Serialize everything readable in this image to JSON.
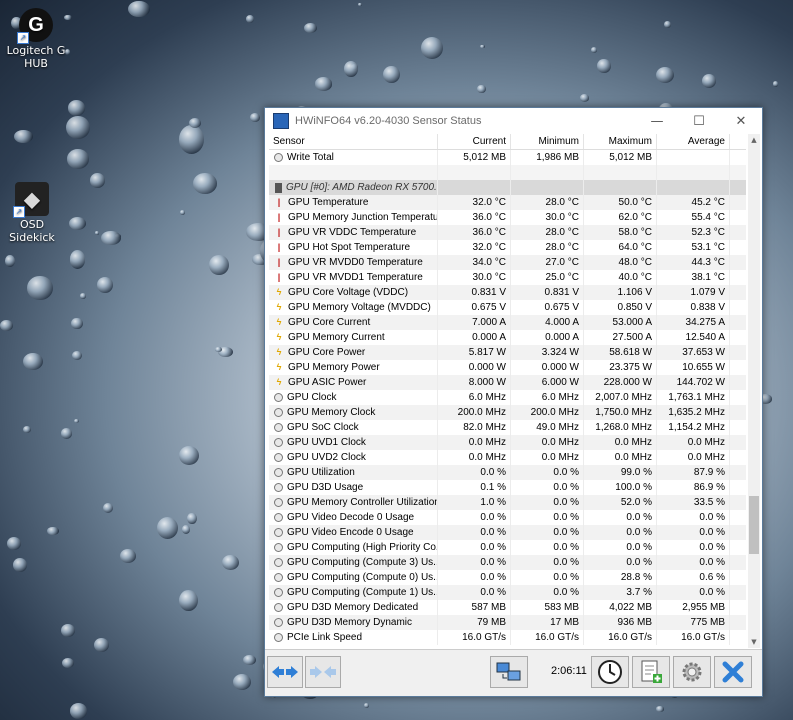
{
  "desktop": {
    "icons": [
      {
        "label": "Logitech G HUB",
        "glyph": "G"
      },
      {
        "label": "OSD Sidekick",
        "glyph": "◆"
      }
    ]
  },
  "window": {
    "title": "HWiNFO64 v6.20-4030 Sensor Status",
    "controls": {
      "minimize": "—",
      "maximize": "☐",
      "close": "✕"
    }
  },
  "table": {
    "columns": [
      "Sensor",
      "Current",
      "Minimum",
      "Maximum",
      "Average"
    ],
    "rows": [
      {
        "icon": "clock",
        "name": "Write Total",
        "current": "5,012 MB",
        "minimum": "1,986 MB",
        "maximum": "5,012 MB",
        "average": ""
      },
      {
        "icon": "blank",
        "name": "",
        "current": "",
        "minimum": "",
        "maximum": "",
        "average": ""
      },
      {
        "icon": "chip",
        "name": "GPU [#0]: AMD Radeon RX 5700...",
        "current": "",
        "minimum": "",
        "maximum": "",
        "average": "",
        "group": true
      },
      {
        "icon": "temp",
        "name": "GPU Temperature",
        "current": "32.0 °C",
        "minimum": "28.0 °C",
        "maximum": "50.0 °C",
        "average": "45.2 °C"
      },
      {
        "icon": "temp",
        "name": "GPU Memory Junction Temperature",
        "current": "36.0 °C",
        "minimum": "30.0 °C",
        "maximum": "62.0 °C",
        "average": "55.4 °C"
      },
      {
        "icon": "temp",
        "name": "GPU VR VDDC Temperature",
        "current": "36.0 °C",
        "minimum": "28.0 °C",
        "maximum": "58.0 °C",
        "average": "52.3 °C"
      },
      {
        "icon": "temp",
        "name": "GPU Hot Spot Temperature",
        "current": "32.0 °C",
        "minimum": "28.0 °C",
        "maximum": "64.0 °C",
        "average": "53.1 °C"
      },
      {
        "icon": "temp",
        "name": "GPU VR MVDD0 Temperature",
        "current": "34.0 °C",
        "minimum": "27.0 °C",
        "maximum": "48.0 °C",
        "average": "44.3 °C"
      },
      {
        "icon": "temp",
        "name": "GPU VR MVDD1 Temperature",
        "current": "30.0 °C",
        "minimum": "25.0 °C",
        "maximum": "40.0 °C",
        "average": "38.1 °C"
      },
      {
        "icon": "volt",
        "name": "GPU Core Voltage (VDDC)",
        "current": "0.831 V",
        "minimum": "0.831 V",
        "maximum": "1.106 V",
        "average": "1.079 V"
      },
      {
        "icon": "volt",
        "name": "GPU Memory Voltage (MVDDC)",
        "current": "0.675 V",
        "minimum": "0.675 V",
        "maximum": "0.850 V",
        "average": "0.838 V"
      },
      {
        "icon": "volt",
        "name": "GPU Core Current",
        "current": "7.000 A",
        "minimum": "4.000 A",
        "maximum": "53.000 A",
        "average": "34.275 A"
      },
      {
        "icon": "volt",
        "name": "GPU Memory Current",
        "current": "0.000 A",
        "minimum": "0.000 A",
        "maximum": "27.500 A",
        "average": "12.540 A"
      },
      {
        "icon": "volt",
        "name": "GPU Core Power",
        "current": "5.817 W",
        "minimum": "3.324 W",
        "maximum": "58.618 W",
        "average": "37.653 W"
      },
      {
        "icon": "volt",
        "name": "GPU Memory Power",
        "current": "0.000 W",
        "minimum": "0.000 W",
        "maximum": "23.375 W",
        "average": "10.655 W"
      },
      {
        "icon": "volt",
        "name": "GPU ASIC Power",
        "current": "8.000 W",
        "minimum": "6.000 W",
        "maximum": "228.000 W",
        "average": "144.702 W"
      },
      {
        "icon": "clock",
        "name": "GPU Clock",
        "current": "6.0 MHz",
        "minimum": "6.0 MHz",
        "maximum": "2,007.0 MHz",
        "average": "1,763.1 MHz"
      },
      {
        "icon": "clock",
        "name": "GPU Memory Clock",
        "current": "200.0 MHz",
        "minimum": "200.0 MHz",
        "maximum": "1,750.0 MHz",
        "average": "1,635.2 MHz"
      },
      {
        "icon": "clock",
        "name": "GPU SoC Clock",
        "current": "82.0 MHz",
        "minimum": "49.0 MHz",
        "maximum": "1,268.0 MHz",
        "average": "1,154.2 MHz"
      },
      {
        "icon": "clock",
        "name": "GPU UVD1 Clock",
        "current": "0.0 MHz",
        "minimum": "0.0 MHz",
        "maximum": "0.0 MHz",
        "average": "0.0 MHz"
      },
      {
        "icon": "clock",
        "name": "GPU UVD2 Clock",
        "current": "0.0 MHz",
        "minimum": "0.0 MHz",
        "maximum": "0.0 MHz",
        "average": "0.0 MHz"
      },
      {
        "icon": "clock",
        "name": "GPU Utilization",
        "current": "0.0 %",
        "minimum": "0.0 %",
        "maximum": "99.0 %",
        "average": "87.9 %"
      },
      {
        "icon": "clock",
        "name": "GPU D3D Usage",
        "current": "0.1 %",
        "minimum": "0.0 %",
        "maximum": "100.0 %",
        "average": "86.9 %"
      },
      {
        "icon": "clock",
        "name": "GPU Memory Controller Utilization",
        "current": "1.0 %",
        "minimum": "0.0 %",
        "maximum": "52.0 %",
        "average": "33.5 %"
      },
      {
        "icon": "clock",
        "name": "GPU Video Decode 0 Usage",
        "current": "0.0 %",
        "minimum": "0.0 %",
        "maximum": "0.0 %",
        "average": "0.0 %"
      },
      {
        "icon": "clock",
        "name": "GPU Video Encode 0 Usage",
        "current": "0.0 %",
        "minimum": "0.0 %",
        "maximum": "0.0 %",
        "average": "0.0 %"
      },
      {
        "icon": "clock",
        "name": "GPU Computing (High Priority Co...",
        "current": "0.0 %",
        "minimum": "0.0 %",
        "maximum": "0.0 %",
        "average": "0.0 %"
      },
      {
        "icon": "clock",
        "name": "GPU Computing (Compute 3) Us...",
        "current": "0.0 %",
        "minimum": "0.0 %",
        "maximum": "0.0 %",
        "average": "0.0 %"
      },
      {
        "icon": "clock",
        "name": "GPU Computing (Compute 0) Us...",
        "current": "0.0 %",
        "minimum": "0.0 %",
        "maximum": "28.8 %",
        "average": "0.6 %"
      },
      {
        "icon": "clock",
        "name": "GPU Computing (Compute 1) Us...",
        "current": "0.0 %",
        "minimum": "0.0 %",
        "maximum": "3.7 %",
        "average": "0.0 %"
      },
      {
        "icon": "clock",
        "name": "GPU D3D Memory Dedicated",
        "current": "587 MB",
        "minimum": "583 MB",
        "maximum": "4,022 MB",
        "average": "2,955 MB"
      },
      {
        "icon": "clock",
        "name": "GPU D3D Memory Dynamic",
        "current": "79 MB",
        "minimum": "17 MB",
        "maximum": "936 MB",
        "average": "775 MB"
      },
      {
        "icon": "clock",
        "name": "PCIe Link Speed",
        "current": "16.0 GT/s",
        "minimum": "16.0 GT/s",
        "maximum": "16.0 GT/s",
        "average": "16.0 GT/s"
      }
    ]
  },
  "footer": {
    "elapsed_time": "2:06:11",
    "colors": {
      "arrow_active": "#2f7fd6",
      "arrow_inactive": "#a9c8ea",
      "close_x": "#2f7fd6"
    }
  }
}
